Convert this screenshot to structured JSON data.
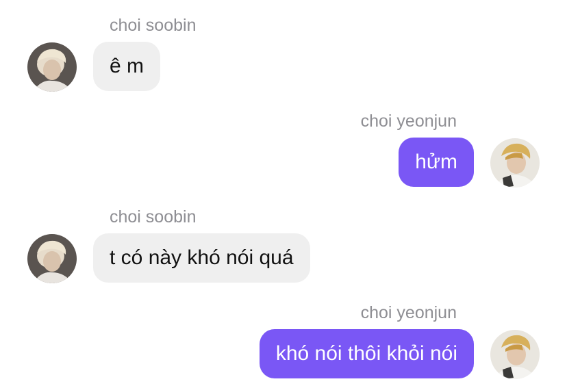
{
  "messages": [
    {
      "sender": "choi soobin",
      "text": "ê m",
      "side": "incoming"
    },
    {
      "sender": "choi yeonjun",
      "text": "hửm",
      "side": "outgoing"
    },
    {
      "sender": "choi soobin",
      "text": "t có này khó nói quá",
      "side": "incoming"
    },
    {
      "sender": "choi yeonjun",
      "text": "khó nói thôi khỏi nói",
      "side": "outgoing"
    }
  ],
  "colors": {
    "incoming_bubble": "#efefef",
    "outgoing_bubble": "#7a57f5",
    "sender_name": "#8e8e93"
  },
  "icons": {
    "soobin_avatar": "profile-photo",
    "yeonjun_avatar": "profile-photo"
  }
}
